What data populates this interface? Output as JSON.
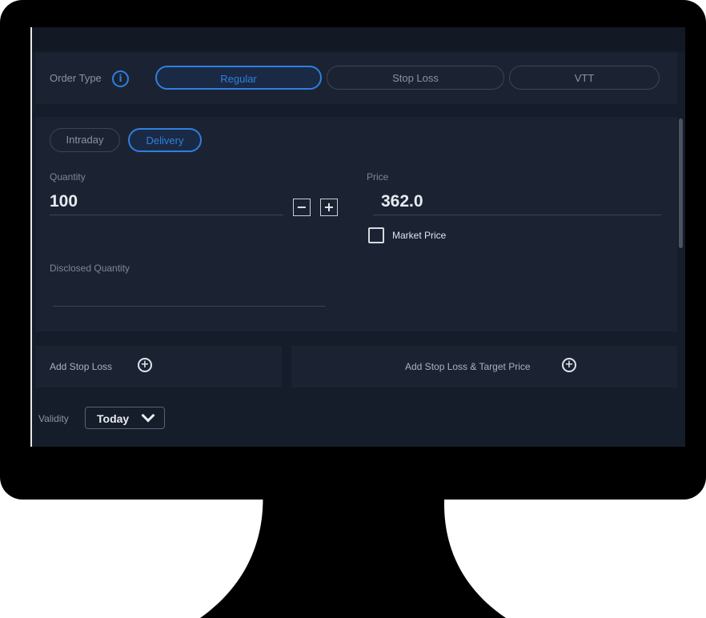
{
  "header": {
    "title": "",
    "right_text": ""
  },
  "order_type": {
    "label": "Order Type",
    "info_icon": "info-icon",
    "options": [
      {
        "label": "Regular",
        "active": true
      },
      {
        "label": "Stop Loss",
        "active": false
      },
      {
        "label": "VTT",
        "active": false
      }
    ]
  },
  "product": {
    "options": [
      {
        "label": "Intraday",
        "active": false
      },
      {
        "label": "Delivery",
        "active": true
      }
    ]
  },
  "quantity": {
    "label": "Quantity",
    "value": "100",
    "decrement": "−",
    "increment": "+"
  },
  "price": {
    "label": "Price",
    "value": "362.0",
    "market_price_label": "Market Price",
    "market_price_checked": false
  },
  "disclosed_quantity": {
    "label": "Disclosed Quantity",
    "value": ""
  },
  "stop_loss": {
    "add_label": "Add Stop Loss",
    "add_target_label": "Add Stop Loss & Target Price",
    "icon": "plus-circle-icon"
  },
  "validity": {
    "label": "Validity",
    "selected": "Today"
  },
  "colors": {
    "accent": "#2f7fe0",
    "panel": "#1b2333",
    "screen": "#161d2a"
  }
}
